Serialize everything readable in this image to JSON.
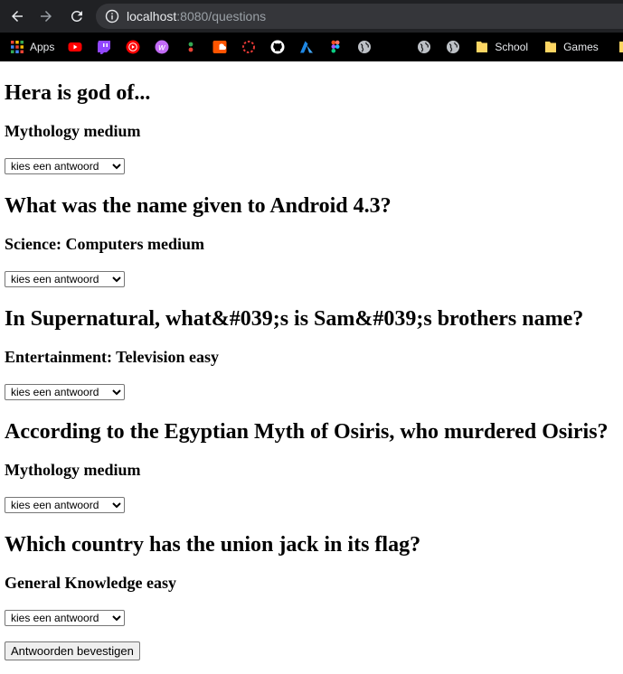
{
  "browser": {
    "url_host": "localhost",
    "url_path": ":8080/questions",
    "bookmarks": {
      "apps_label": "Apps",
      "school_label": "School",
      "games_label": "Games"
    }
  },
  "questions": [
    {
      "title": "Hera is god of...",
      "category": "Mythology medium",
      "select_value": "kies een antwoord"
    },
    {
      "title": "What was the name given to Android 4.3?",
      "category": "Science: Computers medium",
      "select_value": "kies een antwoord"
    },
    {
      "title": "In Supernatural, what&#039;s is Sam&#039;s brothers name?",
      "category": "Entertainment: Television easy",
      "select_value": "kies een antwoord"
    },
    {
      "title": "According to the Egyptian Myth of Osiris, who murdered Osiris?",
      "category": "Mythology medium",
      "select_value": "kies een antwoord"
    },
    {
      "title": "Which country has the union jack in its flag?",
      "category": "General Knowledge easy",
      "select_value": "kies een antwoord"
    }
  ],
  "submit_label": "Antwoorden bevestigen"
}
